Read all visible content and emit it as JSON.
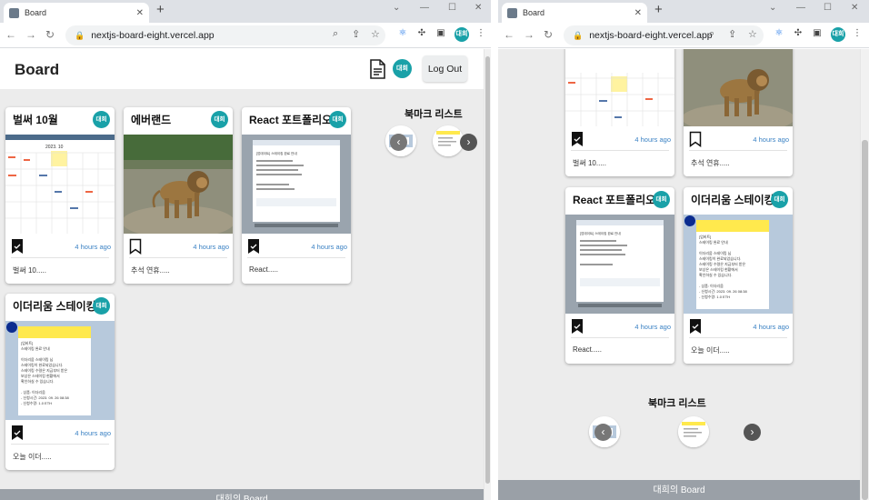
{
  "browser": {
    "tab_title": "Board",
    "url": "nextjs-board-eight.vercel.app",
    "profile_label": "대희"
  },
  "app": {
    "logo": "Board",
    "avatar_label": "대희",
    "logout_label": "Log Out",
    "bookmark_title": "북마크 리스트",
    "footer": "대희의 Board"
  },
  "posts": [
    {
      "title": "벌써 10월",
      "avatar": "대희",
      "time": "4 hours ago",
      "preview": "벌써 10.....",
      "bookmarked": true,
      "image": "calendar"
    },
    {
      "title": "에버랜드",
      "avatar": "대희",
      "time": "4 hours ago",
      "preview": "추석 연휴.....",
      "bookmarked": false,
      "image": "lion"
    },
    {
      "title": "React 포트폴리오",
      "avatar": "대희",
      "time": "4 hours ago",
      "preview": "React.....",
      "bookmarked": true,
      "image": "chat-screenshot"
    },
    {
      "title": "이더리움 스테이킹",
      "avatar": "대희",
      "time": "4 hours ago",
      "preview": "오늘 이더.....",
      "bookmarked": true,
      "image": "staking-screenshot"
    }
  ],
  "post_images": {
    "calendar_heading": "2023. 10",
    "chat_caption": "[업데이트] 스테이킹 완료 안내",
    "staking_lines": [
      "[업비트]",
      "스테이킹 완료 안내",
      "",
      "이더리움 스테이킹 님",
      "스테이킹이 완료되었습니다.",
      "스테이킹 수령은 지금부터 받은",
      "보상은 스테이킹 현황에서",
      "확인하실 수 있습니다.",
      "",
      "- 상품: 이더리움",
      "- 신청시간: 2023. 09. 26 08:38",
      "- 신청수량: 1.0 ETH"
    ]
  },
  "icons": {
    "bookmark_filled": "bookmark-filled-icon",
    "bookmark_empty": "bookmark-outline-icon",
    "document": "document-icon",
    "prev": "chevron-left-icon",
    "next": "chevron-right-icon"
  },
  "colors": {
    "accent": "#19a1a8",
    "time_text": "#3b82c4",
    "footer_bg": "#9aa0a7",
    "board_bg": "#ececec"
  }
}
